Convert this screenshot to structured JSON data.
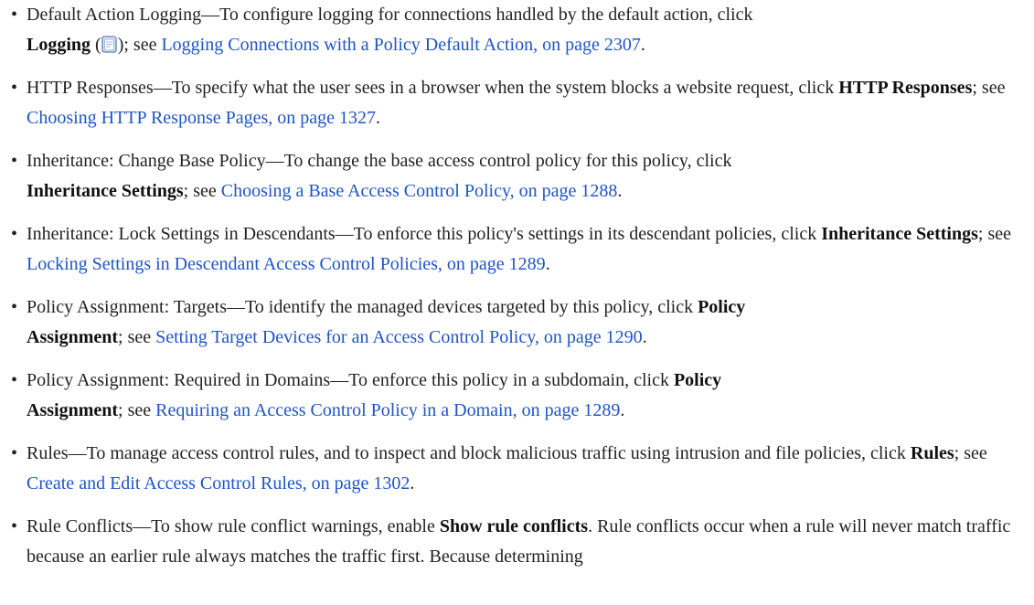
{
  "link_color": "#1f54c8",
  "items": [
    {
      "lead": "Default Action Logging—To configure logging for connections handled by the default action, click",
      "bold": "Logging",
      "paren_open": " (",
      "icon": "logging-document-icon",
      "after_icon": "); see ",
      "link": "Logging Connections with a Policy Default Action, on page 2307",
      "end": "."
    },
    {
      "lead": "HTTP Responses—To specify what the user sees in a browser when the system blocks a website request, click ",
      "bold": "HTTP Responses",
      "mid": "; see ",
      "link": "Choosing HTTP Response Pages, on page 1327",
      "end": "."
    },
    {
      "lead": "Inheritance: Change Base Policy—To change the base access control policy for this policy, click",
      "bold": "Inheritance Settings",
      "mid": "; see ",
      "link": "Choosing a Base Access Control Policy, on page 1288",
      "end": "."
    },
    {
      "lead": "Inheritance: Lock Settings in Descendants—To enforce this policy's settings in its descendant policies, click ",
      "bold": "Inheritance Settings",
      "mid": "; see ",
      "link": "Locking Settings in Descendant Access Control Policies, on page 1289",
      "end": "."
    },
    {
      "lead": "Policy Assignment: Targets—To identify the managed devices targeted by this policy, click ",
      "bold1": "Policy",
      "bold2": "Assignment",
      "mid": "; see ",
      "link": "Setting Target Devices for an Access Control Policy, on page 1290",
      "end": "."
    },
    {
      "lead": "Policy Assignment: Required in Domains—To enforce this policy in a subdomain, click ",
      "bold1": "Policy",
      "bold2": "Assignment",
      "mid": "; see ",
      "link": "Requiring an Access Control Policy in a Domain, on page 1289",
      "end": "."
    },
    {
      "lead": "Rules—To manage access control rules, and to inspect and block malicious traffic using intrusion and file policies, click ",
      "bold": "Rules",
      "mid": "; see ",
      "link": "Create and Edit Access Control Rules, on page 1302",
      "end": "."
    },
    {
      "lead": "Rule Conflicts—To show rule conflict warnings, enable ",
      "bold": "Show rule conflicts",
      "tail": ". Rule conflicts occur when a rule will never match traffic because an earlier rule always matches the traffic first. Because determining"
    }
  ]
}
